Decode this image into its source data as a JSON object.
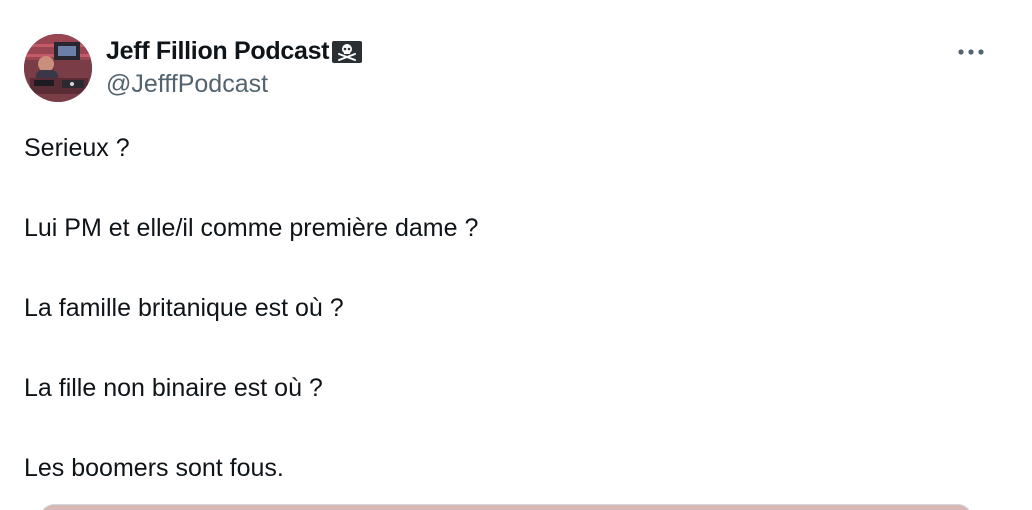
{
  "author": {
    "display_name": "Jeff Fillion Podcast",
    "handle": "@JefffPodcast",
    "name_emoji": "pirate-flag-icon"
  },
  "tweet": {
    "lines": [
      "Serieux ?",
      "Lui PM et elle/il comme première dame ?",
      "La famille britanique est où ?",
      "La fille non binaire est où ?",
      "Les boomers sont fous."
    ]
  },
  "colors": {
    "text": "#0f1419",
    "secondary_text": "#536471",
    "border": "#cfd9de"
  }
}
